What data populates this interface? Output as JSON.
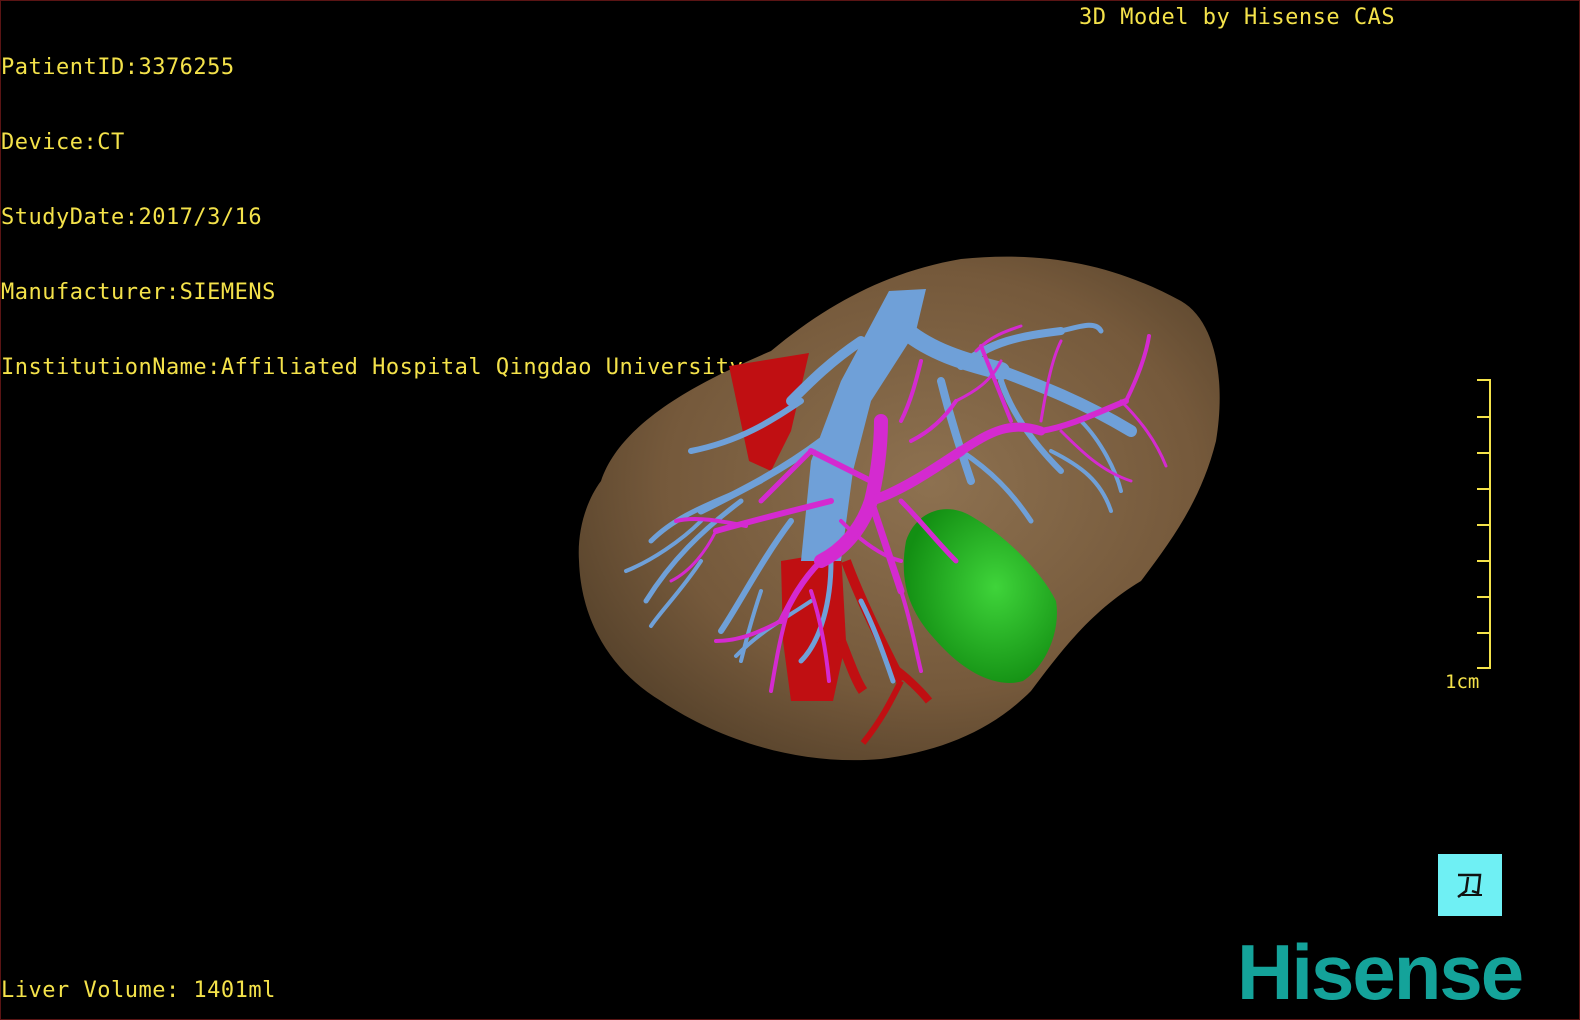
{
  "dicom_info": {
    "patient_id": "PatientID:3376255",
    "device": "Device:CT",
    "study_date": "StudyDate:2017/3/16",
    "manufacturer": "Manufacturer:SIEMENS",
    "institution": "InstitutionName:Affiliated Hospital Qingdao University-C"
  },
  "credit": "3D Model by Hisense CAS",
  "liver_volume": "Liver Volume: 1401ml",
  "scale_bar": {
    "label": "1cm"
  },
  "orientation_button": {
    "icon": "orientation-icon"
  },
  "logo": "Hisense",
  "colors": {
    "overlay_text": "#f4e24a",
    "liver": "#7a6042",
    "portal_vein": "#6fa0d8",
    "hepatic_artery": "#c00f12",
    "hepatic_vein": "#d42ad0",
    "gallbladder": "#1fb41f",
    "logo": "#14a39a",
    "orient_button": "#6ff0f4"
  }
}
